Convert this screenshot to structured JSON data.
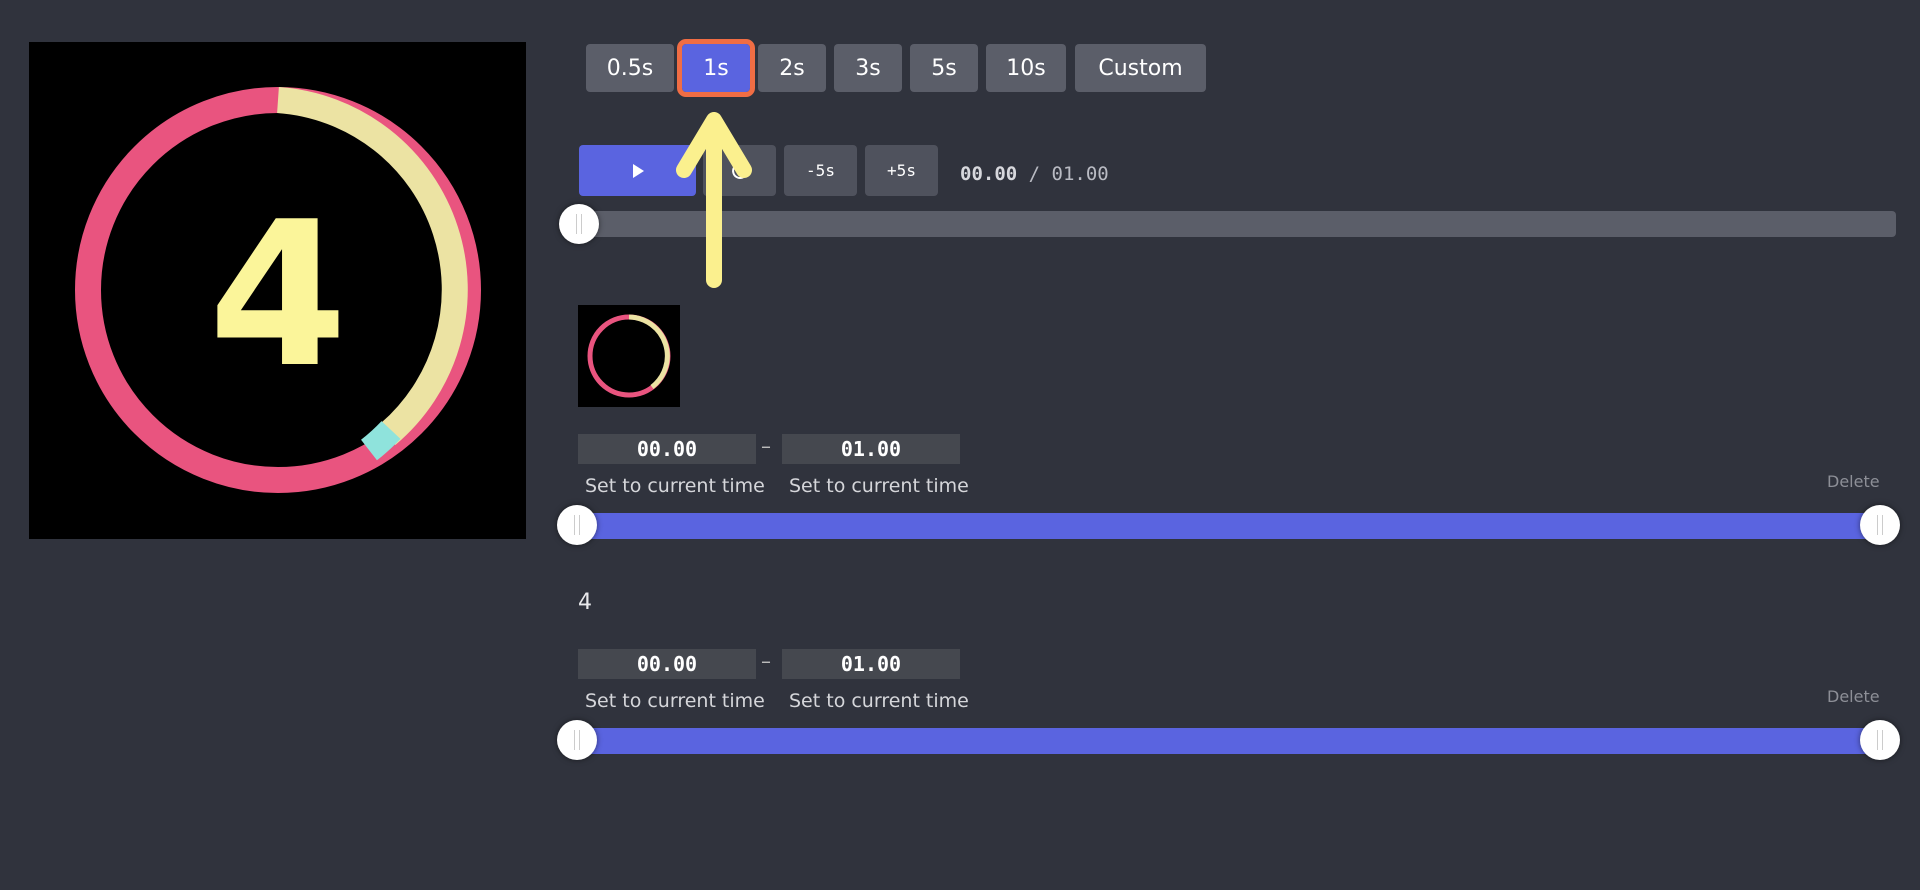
{
  "preview": {
    "number": "4",
    "ring_colors": [
      "#e9547f",
      "#ece3a3",
      "#8fe3dc"
    ],
    "digit_color": "#fbf59a"
  },
  "durations": {
    "options": [
      "0.5s",
      "1s",
      "2s",
      "3s",
      "5s",
      "10s",
      "Custom"
    ],
    "selected": "1s",
    "accent": "#5a64e0",
    "highlight": "#f06d44"
  },
  "controls": {
    "play_icon": "play-icon",
    "restart_icon": "restart-icon",
    "back_label": "-5s",
    "forward_label": "+5s",
    "current_time": "00.00",
    "separator": " / ",
    "total_time": "01.00",
    "progress": 0
  },
  "segments": [
    {
      "title": "",
      "has_thumbnail": true,
      "start": "00.00",
      "end": "01.00",
      "dash": "–",
      "set_start_label": "Set to current time",
      "set_end_label": "Set to current time",
      "delete_label": "Delete",
      "range": [
        0,
        1
      ]
    },
    {
      "title": "4",
      "has_thumbnail": false,
      "start": "00.00",
      "end": "01.00",
      "dash": "–",
      "set_start_label": "Set to current time",
      "set_end_label": "Set to current time",
      "delete_label": "Delete",
      "range": [
        0,
        1
      ]
    }
  ],
  "annotation": {
    "type": "arrow-up",
    "color": "#fbf08e"
  }
}
